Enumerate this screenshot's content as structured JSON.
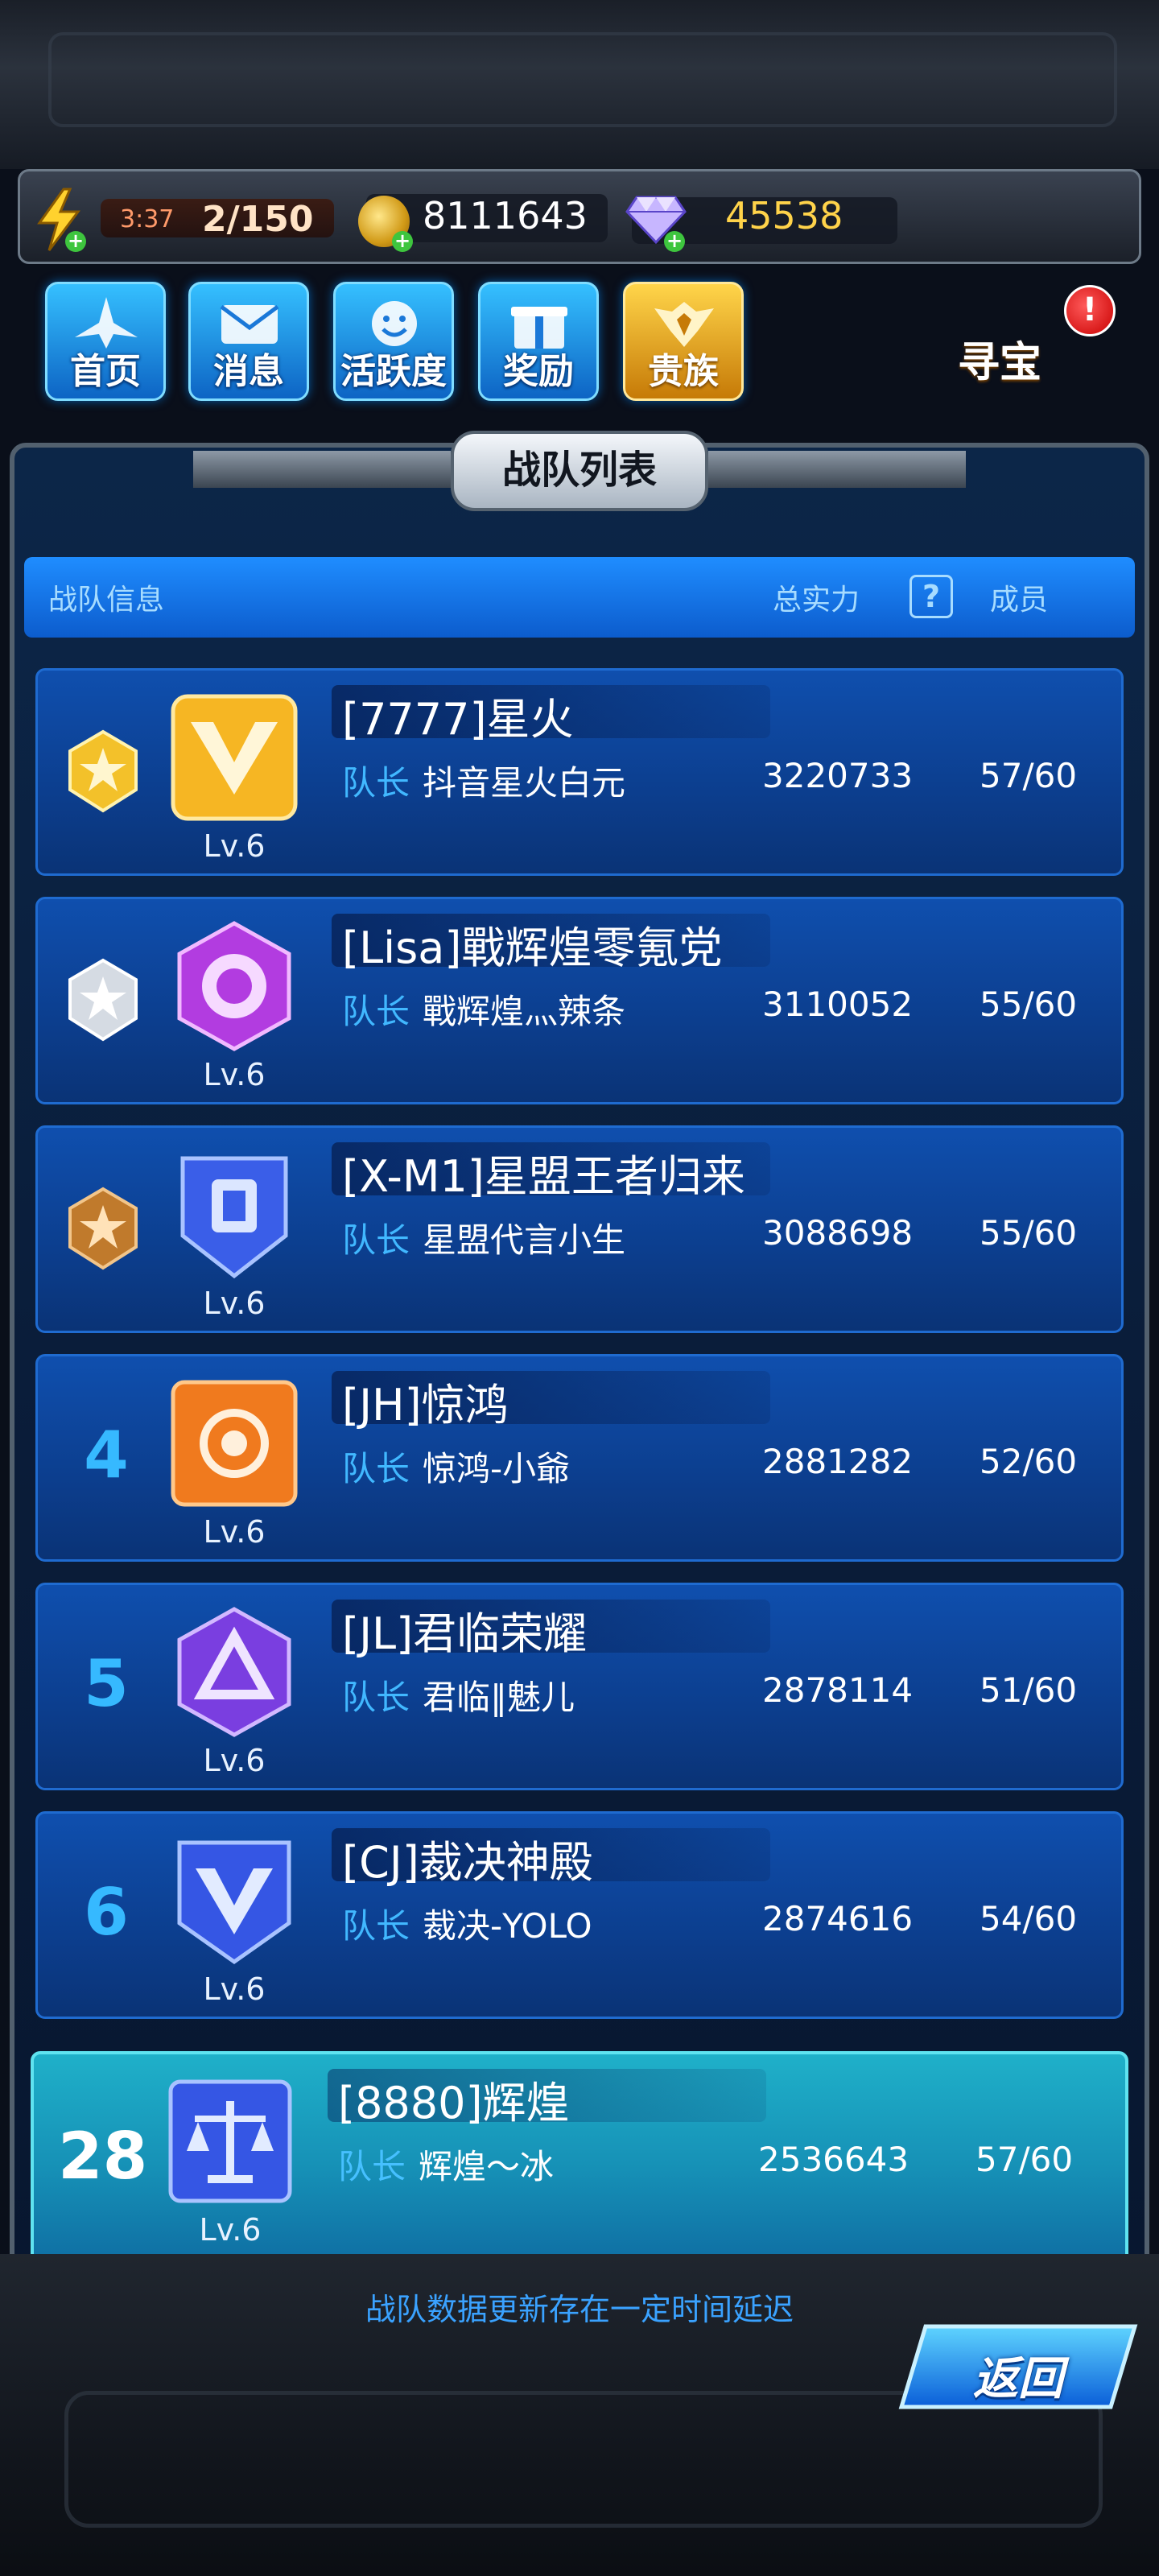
{
  "resources": {
    "timer": "3:37",
    "energy": "2/150",
    "gold": "8111643",
    "diamonds": "45538"
  },
  "nav": {
    "home": "首页",
    "messages": "消息",
    "activity": "活跃度",
    "rewards": "奖励",
    "noble": "贵族",
    "treasure": "寻宝",
    "treasure_badge": "!"
  },
  "panel": {
    "title": "战队列表",
    "header_info": "战队信息",
    "header_power": "总实力",
    "header_help": "?",
    "header_members": "成员"
  },
  "captain_label": "队长",
  "teams": [
    {
      "rank": "1",
      "name": "[7777]星火",
      "captain": "抖音星火白元",
      "power": "3220733",
      "members": "57/60",
      "level": "Lv.6"
    },
    {
      "rank": "2",
      "name": "[Lisa]戰辉煌零氪党",
      "captain": "戰辉煌灬辣条",
      "power": "3110052",
      "members": "55/60",
      "level": "Lv.6"
    },
    {
      "rank": "3",
      "name": "[X-M1]星盟王者归来",
      "captain": "星盟代言小生",
      "power": "3088698",
      "members": "55/60",
      "level": "Lv.6"
    },
    {
      "rank": "4",
      "name": "[JH]惊鸿",
      "captain": "惊鸿-小爺",
      "power": "2881282",
      "members": "52/60",
      "level": "Lv.6"
    },
    {
      "rank": "5",
      "name": "[JL]君临荣耀",
      "captain": "君临‖魅儿",
      "power": "2878114",
      "members": "51/60",
      "level": "Lv.6"
    },
    {
      "rank": "6",
      "name": "[CJ]裁决神殿",
      "captain": "裁决-YOLO",
      "power": "2874616",
      "members": "54/60",
      "level": "Lv.6"
    }
  ],
  "my_team": {
    "rank": "28",
    "name": "[8880]辉煌",
    "captain": "辉煌～冰",
    "power": "2536643",
    "members": "57/60",
    "level": "Lv.6"
  },
  "notice": "战队数据更新存在一定时间延迟",
  "back": "返回",
  "colors": {
    "accent_blue": "#1f8dff",
    "highlight_cyan": "#1fb0c9",
    "gold": "#ffd34a"
  }
}
